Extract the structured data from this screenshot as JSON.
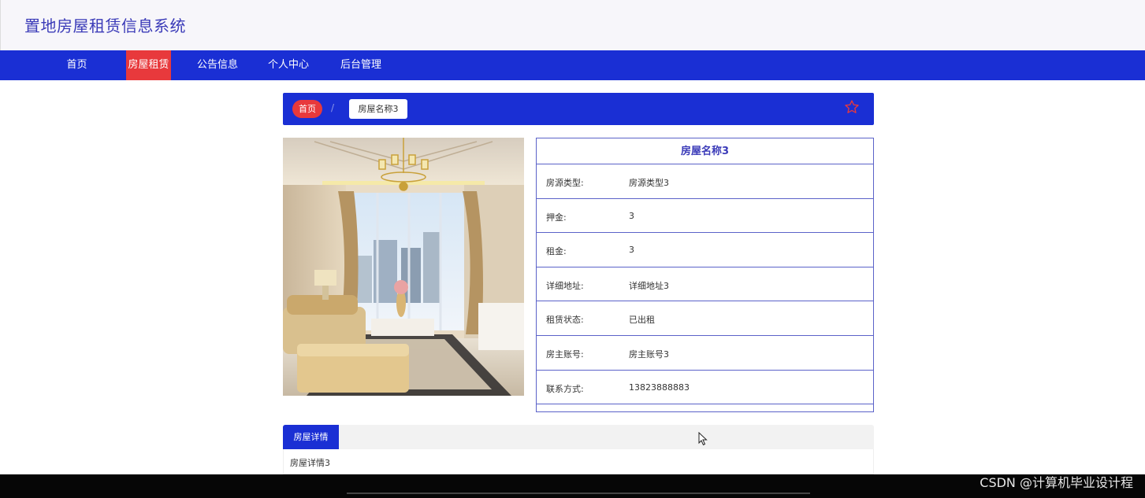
{
  "site": {
    "title": "置地房屋租赁信息系统"
  },
  "nav": {
    "items": [
      {
        "label": "首页"
      },
      {
        "label": "房屋租赁"
      },
      {
        "label": "公告信息"
      },
      {
        "label": "个人中心"
      },
      {
        "label": "后台管理"
      }
    ],
    "active_index": 1
  },
  "breadcrumb": {
    "home": "首页",
    "separator": "/",
    "current": "房屋名称3"
  },
  "house": {
    "name": "房屋名称3",
    "fields": [
      {
        "label": "房源类型:",
        "value": "房源类型3"
      },
      {
        "label": "押金:",
        "value": "3"
      },
      {
        "label": "租金:",
        "value": "3"
      },
      {
        "label": "详细地址:",
        "value": "详细地址3"
      },
      {
        "label": "租赁状态:",
        "value": "已出租"
      },
      {
        "label": "房主账号:",
        "value": "房主账号3"
      },
      {
        "label": "联系方式:",
        "value": "13823888883"
      }
    ]
  },
  "details": {
    "tab_label": "房屋详情",
    "content": "房屋详情3"
  },
  "watermark": "CSDN @计算机毕业设计程",
  "icons": {
    "favorite": "star-outline-icon",
    "cursor": "mouse-pointer-icon"
  },
  "colors": {
    "primary": "#1a2fd4",
    "accent": "#e8393c",
    "title": "#3a3ab8"
  }
}
